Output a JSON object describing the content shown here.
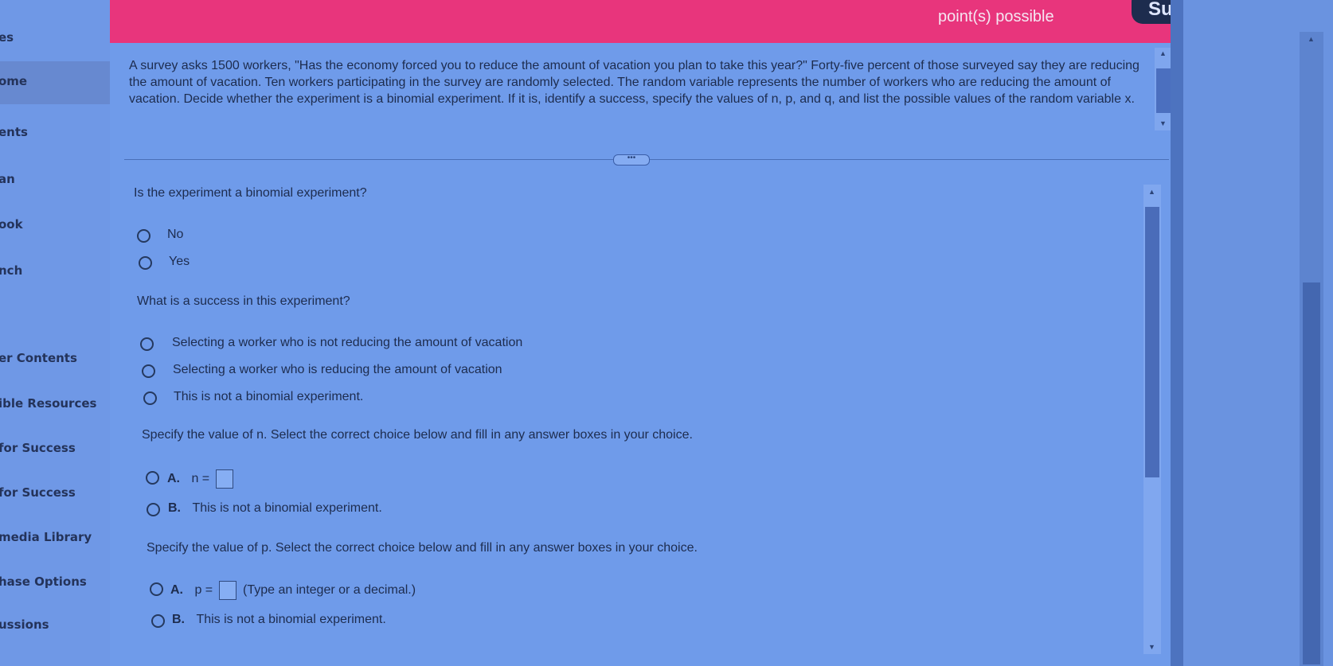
{
  "sidebar": {
    "items": [
      {
        "label": "es",
        "active": false
      },
      {
        "label": "ome",
        "active": true
      },
      {
        "label": "ents",
        "active": false
      },
      {
        "label": "an",
        "active": false
      },
      {
        "label": "ook",
        "active": false
      },
      {
        "label": "nch",
        "active": false
      },
      {
        "label": "er Contents",
        "active": false
      },
      {
        "label": "ible Resources",
        "active": false
      },
      {
        "label": "for Success",
        "active": false
      },
      {
        "label": "for Success",
        "active": false
      },
      {
        "label": "media Library",
        "active": false
      },
      {
        "label": "hase Options",
        "active": false
      },
      {
        "label": "ussions",
        "active": false
      }
    ]
  },
  "header": {
    "points": "point(s) possible",
    "submit_label": "Submit quiz"
  },
  "question": {
    "text": "A survey asks 1500 workers, \"Has the economy forced you to reduce the amount of vacation you plan to take this year?\" Forty-five percent of those surveyed say they are reducing the amount of vacation. Ten workers participating in the survey are randomly selected. The random variable represents the number of workers who are reducing the amount of vacation. Decide whether the experiment is a binomial experiment. If it is, identify a success, specify the values of n, p, and q, and list the possible values of the random variable x."
  },
  "parts": {
    "q1": {
      "prompt": "Is the experiment a binomial experiment?",
      "options": [
        "No",
        "Yes"
      ]
    },
    "q2": {
      "prompt": "What is a success in this experiment?",
      "options": [
        "Selecting a worker who is not reducing the amount of vacation",
        "Selecting a worker who is reducing the amount of vacation",
        "This is not a binomial experiment."
      ]
    },
    "q3": {
      "prompt": "Specify the value of n. Select the correct choice below and fill in any answer boxes in your choice.",
      "a_letter": "A.",
      "a_text": "n =",
      "b_letter": "B.",
      "b_text": "This is not a binomial experiment."
    },
    "q4": {
      "prompt": "Specify the value of p. Select the correct choice below and fill in any answer boxes in your choice.",
      "a_letter": "A.",
      "a_text": "p =",
      "a_hint": "(Type an integer or a decimal.)",
      "b_letter": "B.",
      "b_text": "This is not a binomial experiment."
    }
  },
  "colors": {
    "header": "#e8357c",
    "panel": "#6f9bea",
    "submit": "#1d2c4e"
  }
}
